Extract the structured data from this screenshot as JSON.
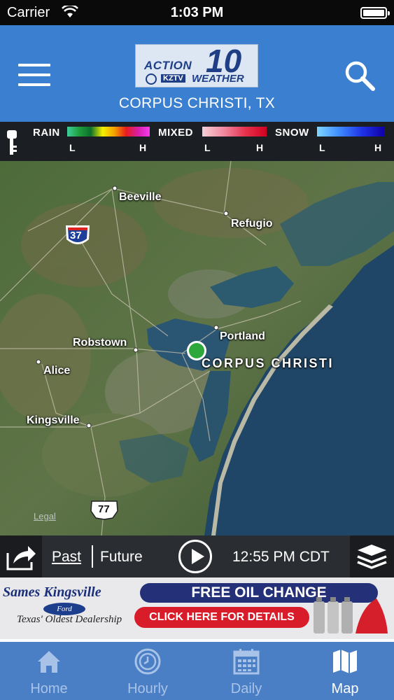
{
  "status_bar": {
    "carrier": "Carrier",
    "time": "1:03 PM"
  },
  "header": {
    "logo": {
      "action": "ACTION",
      "number": "10",
      "station": "KZTV",
      "weather": "WEATHER"
    },
    "location": "CORPUS CHRISTI, TX"
  },
  "legend": {
    "rain": {
      "label": "RAIN",
      "low": "L",
      "high": "H"
    },
    "mixed": {
      "label": "MIXED",
      "low": "L",
      "high": "H"
    },
    "snow": {
      "label": "SNOW",
      "low": "L",
      "high": "H"
    }
  },
  "map": {
    "cities": {
      "beeville": "Beeville",
      "refugio": "Refugio",
      "robstown": "Robstown",
      "portland": "Portland",
      "alice": "Alice",
      "kingsville": "Kingsville",
      "corpus_christi": "CORPUS CHRISTI"
    },
    "highways": {
      "interstate": "37",
      "us_route": "77"
    },
    "legal": "Legal"
  },
  "controls": {
    "past": "Past",
    "future": "Future",
    "time": "12:55 PM CDT"
  },
  "ad": {
    "dealer": "Sames Kingsville",
    "brand": "Ford",
    "tagline": "Texas' Oldest Dealership",
    "offer": "FREE OIL CHANGE",
    "cta": "CLICK HERE FOR DETAILS"
  },
  "tabs": [
    {
      "label": "Home",
      "icon": "home-icon",
      "active": false
    },
    {
      "label": "Hourly",
      "icon": "clock-icon",
      "active": false
    },
    {
      "label": "Daily",
      "icon": "calendar-icon",
      "active": false
    },
    {
      "label": "Map",
      "icon": "map-icon",
      "active": true
    }
  ],
  "colors": {
    "header_blue": "#3b7fd0",
    "tab_blue": "#4a7fc6",
    "location_dot": "#2ea83a"
  }
}
